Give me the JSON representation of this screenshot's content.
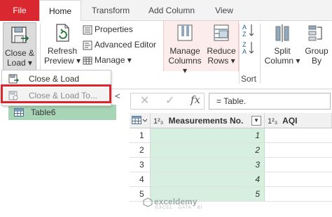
{
  "tabs": [
    {
      "label": "File"
    },
    {
      "label": "Home"
    },
    {
      "label": "Transform"
    },
    {
      "label": "Add Column"
    },
    {
      "label": "View"
    }
  ],
  "ribbon": {
    "close_load": {
      "line1": "Close &",
      "line2": "Load ▾"
    },
    "refresh": {
      "line1": "Refresh",
      "line2": "Preview ▾"
    },
    "properties": "Properties",
    "advanced_editor": "Advanced Editor",
    "manage": "Manage ▾",
    "manage_columns": {
      "line1": "Manage",
      "line2": "Columns ▾"
    },
    "reduce_rows": {
      "line1": "Reduce",
      "line2": "Rows ▾"
    },
    "sort_group": "Sort",
    "split_column": {
      "line1": "Split",
      "line2": "Column ▾"
    },
    "group_by": {
      "line1": "Group",
      "line2": "By"
    }
  },
  "dropdown": {
    "close_load": "Close & Load",
    "close_load_to": "Close & Load To..."
  },
  "navigator": {
    "collapse": "<",
    "query": "Table6"
  },
  "formula_bar": {
    "cancel": "✕",
    "confirm": "✓",
    "fx": "fx",
    "formula": "= Table."
  },
  "grid": {
    "type_badge": "1²₃",
    "columns": [
      "Measurements No.",
      "AQI"
    ],
    "rows": [
      {
        "num": "1",
        "value": "1"
      },
      {
        "num": "2",
        "value": "2"
      },
      {
        "num": "3",
        "value": "3"
      },
      {
        "num": "4",
        "value": "4"
      },
      {
        "num": "5",
        "value": "5"
      }
    ]
  },
  "watermark": {
    "name": "exceldemy",
    "sub": "EXCEL · DATA · BI"
  },
  "colors": {
    "file_tab": "#d9282f",
    "highlight_box": "#e0242b",
    "selected_query": "#a8d5b5",
    "column_fill": "#d6efdf"
  }
}
